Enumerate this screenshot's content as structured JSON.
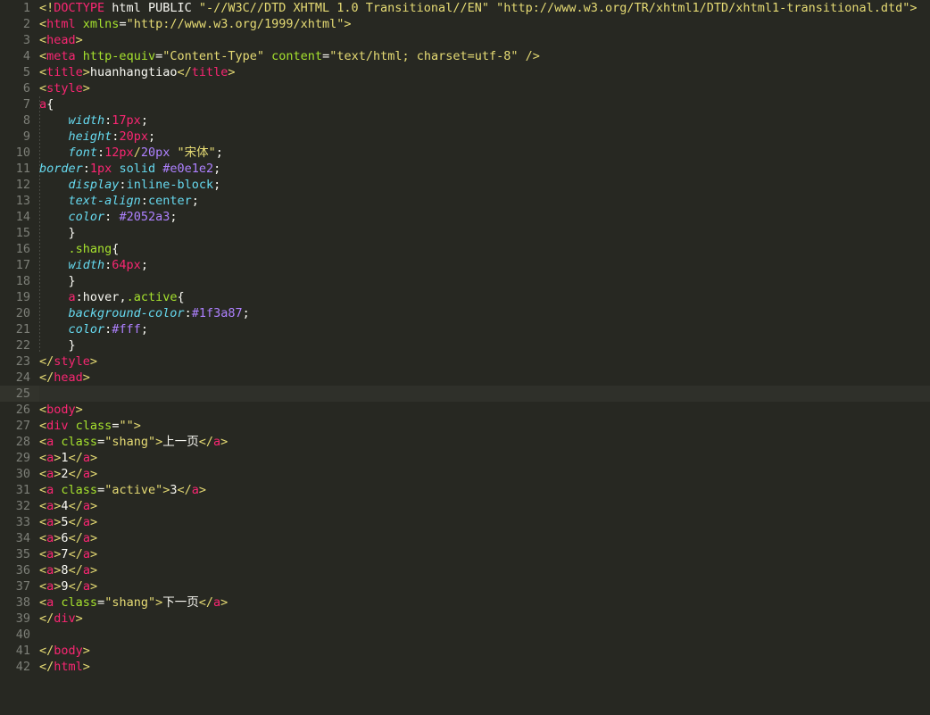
{
  "editor": {
    "title": "huanhangtiao",
    "theme": "monokai",
    "language": "html",
    "total_lines": 42,
    "active_line": 25,
    "colors": {
      "background": "#272822",
      "active_line": "#2f302a",
      "gutter_text": "#7d7f78",
      "foreground": "#f8f8f2",
      "tag": "#f92672",
      "attribute": "#a6e22e",
      "string": "#e6db74",
      "property": "#66d9ef",
      "number": "#f92672",
      "constant": "#ae81ff"
    }
  },
  "lines": [
    {
      "n": 1,
      "tokens": [
        {
          "t": "brack",
          "v": "<!"
        },
        {
          "t": "doctype",
          "v": "DOCTYPE"
        },
        {
          "t": "text",
          "v": " html PUBLIC "
        },
        {
          "t": "string",
          "v": "\"-//W3C//DTD XHTML 1.0 Transitional//EN\""
        },
        {
          "t": "text",
          "v": " "
        },
        {
          "t": "string",
          "v": "\"http://www.w3.org/TR/xhtml1/DTD/xhtml1-transitional.dtd\""
        },
        {
          "t": "brack",
          "v": ">"
        }
      ]
    },
    {
      "n": 2,
      "tokens": [
        {
          "t": "brack",
          "v": "<"
        },
        {
          "t": "tag",
          "v": "html"
        },
        {
          "t": "text",
          "v": " "
        },
        {
          "t": "attr",
          "v": "xmlns"
        },
        {
          "t": "eq",
          "v": "="
        },
        {
          "t": "string",
          "v": "\"http://www.w3.org/1999/xhtml\""
        },
        {
          "t": "brack",
          "v": ">"
        }
      ]
    },
    {
      "n": 3,
      "tokens": [
        {
          "t": "brack",
          "v": "<"
        },
        {
          "t": "tag",
          "v": "head"
        },
        {
          "t": "brack",
          "v": ">"
        }
      ]
    },
    {
      "n": 4,
      "tokens": [
        {
          "t": "brack",
          "v": "<"
        },
        {
          "t": "tag",
          "v": "meta"
        },
        {
          "t": "text",
          "v": " "
        },
        {
          "t": "attr",
          "v": "http-equiv"
        },
        {
          "t": "eq",
          "v": "="
        },
        {
          "t": "string",
          "v": "\"Content-Type\""
        },
        {
          "t": "text",
          "v": " "
        },
        {
          "t": "attr",
          "v": "content"
        },
        {
          "t": "eq",
          "v": "="
        },
        {
          "t": "string",
          "v": "\"text/html; charset=utf-8\""
        },
        {
          "t": "text",
          "v": " "
        },
        {
          "t": "brack",
          "v": "/>"
        }
      ]
    },
    {
      "n": 5,
      "tokens": [
        {
          "t": "brack",
          "v": "<"
        },
        {
          "t": "tag",
          "v": "title"
        },
        {
          "t": "brack",
          "v": ">"
        },
        {
          "t": "text",
          "v": "huanhangtiao"
        },
        {
          "t": "brack",
          "v": "</"
        },
        {
          "t": "tag",
          "v": "title"
        },
        {
          "t": "brack",
          "v": ">"
        }
      ]
    },
    {
      "n": 6,
      "tokens": [
        {
          "t": "brack",
          "v": "<"
        },
        {
          "t": "tag",
          "v": "style"
        },
        {
          "t": "brack",
          "v": ">"
        }
      ]
    },
    {
      "n": 7,
      "tokens": [
        {
          "t": "seltag",
          "v": "a"
        },
        {
          "t": "brace",
          "v": "{"
        }
      ]
    },
    {
      "n": 8,
      "tokens": [
        {
          "t": "text",
          "v": "    "
        },
        {
          "t": "prop",
          "v": "width"
        },
        {
          "t": "brace",
          "v": ":"
        },
        {
          "t": "num",
          "v": "17px"
        },
        {
          "t": "brace",
          "v": ";"
        }
      ]
    },
    {
      "n": 9,
      "tokens": [
        {
          "t": "text",
          "v": "    "
        },
        {
          "t": "prop",
          "v": "height"
        },
        {
          "t": "brace",
          "v": ":"
        },
        {
          "t": "num",
          "v": "20px"
        },
        {
          "t": "brace",
          "v": ";"
        }
      ]
    },
    {
      "n": 10,
      "tokens": [
        {
          "t": "text",
          "v": "    "
        },
        {
          "t": "prop",
          "v": "font"
        },
        {
          "t": "brace",
          "v": ":"
        },
        {
          "t": "num",
          "v": "12px"
        },
        {
          "t": "slash",
          "v": "/"
        },
        {
          "t": "num2",
          "v": "20px"
        },
        {
          "t": "text",
          "v": " "
        },
        {
          "t": "string",
          "v": "\"宋体\""
        },
        {
          "t": "brace",
          "v": ";"
        }
      ]
    },
    {
      "n": 11,
      "tokens": [
        {
          "t": "prop",
          "v": "border"
        },
        {
          "t": "brace",
          "v": ":"
        },
        {
          "t": "num",
          "v": "1px"
        },
        {
          "t": "text",
          "v": " "
        },
        {
          "t": "kw",
          "v": "solid"
        },
        {
          "t": "text",
          "v": " "
        },
        {
          "t": "hex",
          "v": "#e0e1e2"
        },
        {
          "t": "brace",
          "v": ";"
        }
      ]
    },
    {
      "n": 12,
      "tokens": [
        {
          "t": "text",
          "v": "    "
        },
        {
          "t": "prop",
          "v": "display"
        },
        {
          "t": "brace",
          "v": ":"
        },
        {
          "t": "kw",
          "v": "inline-block"
        },
        {
          "t": "brace",
          "v": ";"
        }
      ]
    },
    {
      "n": 13,
      "tokens": [
        {
          "t": "text",
          "v": "    "
        },
        {
          "t": "prop",
          "v": "text-align"
        },
        {
          "t": "brace",
          "v": ":"
        },
        {
          "t": "kw",
          "v": "center"
        },
        {
          "t": "brace",
          "v": ";"
        }
      ]
    },
    {
      "n": 14,
      "tokens": [
        {
          "t": "text",
          "v": "    "
        },
        {
          "t": "prop",
          "v": "color"
        },
        {
          "t": "brace",
          "v": ":"
        },
        {
          "t": "text",
          "v": " "
        },
        {
          "t": "hex",
          "v": "#2052a3"
        },
        {
          "t": "brace",
          "v": ";"
        }
      ]
    },
    {
      "n": 15,
      "tokens": [
        {
          "t": "text",
          "v": "    "
        },
        {
          "t": "brace",
          "v": "}"
        }
      ]
    },
    {
      "n": 16,
      "tokens": [
        {
          "t": "text",
          "v": "    "
        },
        {
          "t": "sel",
          "v": ".shang"
        },
        {
          "t": "brace",
          "v": "{"
        }
      ]
    },
    {
      "n": 17,
      "tokens": [
        {
          "t": "text",
          "v": "    "
        },
        {
          "t": "prop",
          "v": "width"
        },
        {
          "t": "brace",
          "v": ":"
        },
        {
          "t": "num",
          "v": "64px"
        },
        {
          "t": "brace",
          "v": ";"
        }
      ]
    },
    {
      "n": 18,
      "tokens": [
        {
          "t": "text",
          "v": "    "
        },
        {
          "t": "brace",
          "v": "}"
        }
      ]
    },
    {
      "n": 19,
      "tokens": [
        {
          "t": "text",
          "v": "    "
        },
        {
          "t": "seltag",
          "v": "a"
        },
        {
          "t": "pseudo",
          "v": ":hover"
        },
        {
          "t": "pseudo",
          "v": ","
        },
        {
          "t": "sel",
          "v": ".active"
        },
        {
          "t": "brace",
          "v": "{"
        }
      ]
    },
    {
      "n": 20,
      "tokens": [
        {
          "t": "text",
          "v": "    "
        },
        {
          "t": "prop",
          "v": "background-color"
        },
        {
          "t": "brace",
          "v": ":"
        },
        {
          "t": "hex",
          "v": "#1f3a87"
        },
        {
          "t": "brace",
          "v": ";"
        }
      ]
    },
    {
      "n": 21,
      "tokens": [
        {
          "t": "text",
          "v": "    "
        },
        {
          "t": "prop",
          "v": "color"
        },
        {
          "t": "brace",
          "v": ":"
        },
        {
          "t": "hex",
          "v": "#fff"
        },
        {
          "t": "brace",
          "v": ";"
        }
      ]
    },
    {
      "n": 22,
      "tokens": [
        {
          "t": "text",
          "v": "    "
        },
        {
          "t": "brace",
          "v": "}"
        }
      ]
    },
    {
      "n": 23,
      "tokens": [
        {
          "t": "brack",
          "v": "</"
        },
        {
          "t": "tag",
          "v": "style"
        },
        {
          "t": "brack",
          "v": ">"
        }
      ]
    },
    {
      "n": 24,
      "tokens": [
        {
          "t": "brack",
          "v": "</"
        },
        {
          "t": "tag",
          "v": "head"
        },
        {
          "t": "brack",
          "v": ">"
        }
      ]
    },
    {
      "n": 25,
      "tokens": []
    },
    {
      "n": 26,
      "tokens": [
        {
          "t": "brack",
          "v": "<"
        },
        {
          "t": "tag",
          "v": "body"
        },
        {
          "t": "brack",
          "v": ">"
        }
      ]
    },
    {
      "n": 27,
      "tokens": [
        {
          "t": "brack",
          "v": "<"
        },
        {
          "t": "tag",
          "v": "div"
        },
        {
          "t": "text",
          "v": " "
        },
        {
          "t": "attr",
          "v": "class"
        },
        {
          "t": "eq",
          "v": "="
        },
        {
          "t": "string",
          "v": "\"\""
        },
        {
          "t": "brack",
          "v": ">"
        }
      ]
    },
    {
      "n": 28,
      "tokens": [
        {
          "t": "brack",
          "v": "<"
        },
        {
          "t": "tag",
          "v": "a"
        },
        {
          "t": "text",
          "v": " "
        },
        {
          "t": "attr",
          "v": "class"
        },
        {
          "t": "eq",
          "v": "="
        },
        {
          "t": "string",
          "v": "\"shang\""
        },
        {
          "t": "brack",
          "v": ">"
        },
        {
          "t": "text",
          "v": "上一页"
        },
        {
          "t": "brack",
          "v": "</"
        },
        {
          "t": "tag",
          "v": "a"
        },
        {
          "t": "brack",
          "v": ">"
        }
      ]
    },
    {
      "n": 29,
      "tokens": [
        {
          "t": "brack",
          "v": "<"
        },
        {
          "t": "tag",
          "v": "a"
        },
        {
          "t": "brack",
          "v": ">"
        },
        {
          "t": "text",
          "v": "1"
        },
        {
          "t": "brack",
          "v": "</"
        },
        {
          "t": "tag",
          "v": "a"
        },
        {
          "t": "brack",
          "v": ">"
        }
      ]
    },
    {
      "n": 30,
      "tokens": [
        {
          "t": "brack",
          "v": "<"
        },
        {
          "t": "tag",
          "v": "a"
        },
        {
          "t": "brack",
          "v": ">"
        },
        {
          "t": "text",
          "v": "2"
        },
        {
          "t": "brack",
          "v": "</"
        },
        {
          "t": "tag",
          "v": "a"
        },
        {
          "t": "brack",
          "v": ">"
        }
      ]
    },
    {
      "n": 31,
      "tokens": [
        {
          "t": "brack",
          "v": "<"
        },
        {
          "t": "tag",
          "v": "a"
        },
        {
          "t": "text",
          "v": " "
        },
        {
          "t": "attr",
          "v": "class"
        },
        {
          "t": "eq",
          "v": "="
        },
        {
          "t": "string",
          "v": "\"active\""
        },
        {
          "t": "brack",
          "v": ">"
        },
        {
          "t": "text",
          "v": "3"
        },
        {
          "t": "brack",
          "v": "</"
        },
        {
          "t": "tag",
          "v": "a"
        },
        {
          "t": "brack",
          "v": ">"
        }
      ]
    },
    {
      "n": 32,
      "tokens": [
        {
          "t": "brack",
          "v": "<"
        },
        {
          "t": "tag",
          "v": "a"
        },
        {
          "t": "brack",
          "v": ">"
        },
        {
          "t": "text",
          "v": "4"
        },
        {
          "t": "brack",
          "v": "</"
        },
        {
          "t": "tag",
          "v": "a"
        },
        {
          "t": "brack",
          "v": ">"
        }
      ]
    },
    {
      "n": 33,
      "tokens": [
        {
          "t": "brack",
          "v": "<"
        },
        {
          "t": "tag",
          "v": "a"
        },
        {
          "t": "brack",
          "v": ">"
        },
        {
          "t": "text",
          "v": "5"
        },
        {
          "t": "brack",
          "v": "</"
        },
        {
          "t": "tag",
          "v": "a"
        },
        {
          "t": "brack",
          "v": ">"
        }
      ]
    },
    {
      "n": 34,
      "tokens": [
        {
          "t": "brack",
          "v": "<"
        },
        {
          "t": "tag",
          "v": "a"
        },
        {
          "t": "brack",
          "v": ">"
        },
        {
          "t": "text",
          "v": "6"
        },
        {
          "t": "brack",
          "v": "</"
        },
        {
          "t": "tag",
          "v": "a"
        },
        {
          "t": "brack",
          "v": ">"
        }
      ]
    },
    {
      "n": 35,
      "tokens": [
        {
          "t": "brack",
          "v": "<"
        },
        {
          "t": "tag",
          "v": "a"
        },
        {
          "t": "brack",
          "v": ">"
        },
        {
          "t": "text",
          "v": "7"
        },
        {
          "t": "brack",
          "v": "</"
        },
        {
          "t": "tag",
          "v": "a"
        },
        {
          "t": "brack",
          "v": ">"
        }
      ]
    },
    {
      "n": 36,
      "tokens": [
        {
          "t": "brack",
          "v": "<"
        },
        {
          "t": "tag",
          "v": "a"
        },
        {
          "t": "brack",
          "v": ">"
        },
        {
          "t": "text",
          "v": "8"
        },
        {
          "t": "brack",
          "v": "</"
        },
        {
          "t": "tag",
          "v": "a"
        },
        {
          "t": "brack",
          "v": ">"
        }
      ]
    },
    {
      "n": 37,
      "tokens": [
        {
          "t": "brack",
          "v": "<"
        },
        {
          "t": "tag",
          "v": "a"
        },
        {
          "t": "brack",
          "v": ">"
        },
        {
          "t": "text",
          "v": "9"
        },
        {
          "t": "brack",
          "v": "</"
        },
        {
          "t": "tag",
          "v": "a"
        },
        {
          "t": "brack",
          "v": ">"
        }
      ]
    },
    {
      "n": 38,
      "tokens": [
        {
          "t": "brack",
          "v": "<"
        },
        {
          "t": "tag",
          "v": "a"
        },
        {
          "t": "text",
          "v": " "
        },
        {
          "t": "attr",
          "v": "class"
        },
        {
          "t": "eq",
          "v": "="
        },
        {
          "t": "string",
          "v": "\"shang\""
        },
        {
          "t": "brack",
          "v": ">"
        },
        {
          "t": "text",
          "v": "下一页"
        },
        {
          "t": "brack",
          "v": "</"
        },
        {
          "t": "tag",
          "v": "a"
        },
        {
          "t": "brack",
          "v": ">"
        }
      ]
    },
    {
      "n": 39,
      "tokens": [
        {
          "t": "brack",
          "v": "</"
        },
        {
          "t": "tag",
          "v": "div"
        },
        {
          "t": "brack",
          "v": ">"
        }
      ]
    },
    {
      "n": 40,
      "tokens": []
    },
    {
      "n": 41,
      "tokens": [
        {
          "t": "brack",
          "v": "</"
        },
        {
          "t": "tag",
          "v": "body"
        },
        {
          "t": "brack",
          "v": ">"
        }
      ]
    },
    {
      "n": 42,
      "tokens": [
        {
          "t": "brack",
          "v": "</"
        },
        {
          "t": "tag",
          "v": "html"
        },
        {
          "t": "brack",
          "v": ">"
        }
      ]
    }
  ]
}
